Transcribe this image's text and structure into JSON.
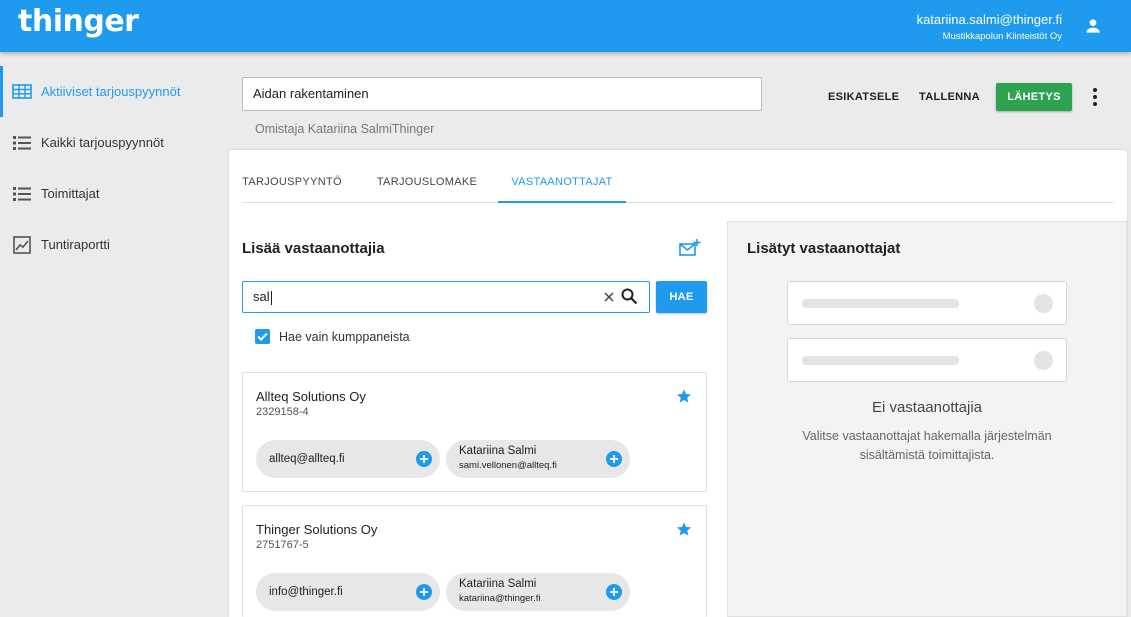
{
  "app": {
    "logo_text": "thinger",
    "user_email": "katariina.salmi@thinger.fi",
    "user_org": "Mustikkapolun Kiinteistöt Oy",
    "accent_color": "#1e9bef",
    "send_color": "#2ea34f"
  },
  "sidebar": {
    "items": [
      {
        "label": "Aktiiviset tarjouspyynnöt",
        "icon": "grid-icon",
        "active": true
      },
      {
        "label": "Kaikki tarjouspyynnöt",
        "icon": "list-icon"
      },
      {
        "label": "Toimittajat",
        "icon": "list-icon"
      },
      {
        "label": "Tuntiraportti",
        "icon": "report-icon"
      }
    ]
  },
  "request": {
    "title_value": "Aidan rakentaminen",
    "owner": "Omistaja Katariina SalmiThinger",
    "preview_label": "ESIKATSELE",
    "save_label": "TALLENNA",
    "send_label": "LÄHETYS"
  },
  "tabs": [
    {
      "label": "TARJOUSPYYNTÖ"
    },
    {
      "label": "TARJOUSLOMAKE"
    },
    {
      "label": "VASTAANOTTAJAT",
      "active": true
    }
  ],
  "add_recipients": {
    "heading": "Lisää vastaanottajia",
    "search_value": "sal",
    "search_button": "HAE",
    "partners_only_label": "Hae vain kumppaneista",
    "partners_only_checked": true,
    "suppliers": [
      {
        "name": "Allteq Solutions Oy",
        "business_id": "2329158-4",
        "starred": true,
        "contacts": [
          {
            "email": "allteq@allteq.fi"
          },
          {
            "name": "Katariina Salmi",
            "email": "sami.vellonen@allteq.fi"
          }
        ]
      },
      {
        "name": "Thinger Solutions Oy",
        "business_id": "2751767-5",
        "starred": true,
        "contacts": [
          {
            "email": "info@thinger.fi"
          },
          {
            "name": "Katariina Salmi",
            "email": "katariina@thinger.fi"
          }
        ]
      }
    ]
  },
  "added_recipients": {
    "heading": "Lisätyt vastaanottajat",
    "empty_title": "Ei vastaanottajia",
    "empty_description": "Valitse vastaanottajat hakemalla järjestelmän sisältämistä toimittajista."
  }
}
